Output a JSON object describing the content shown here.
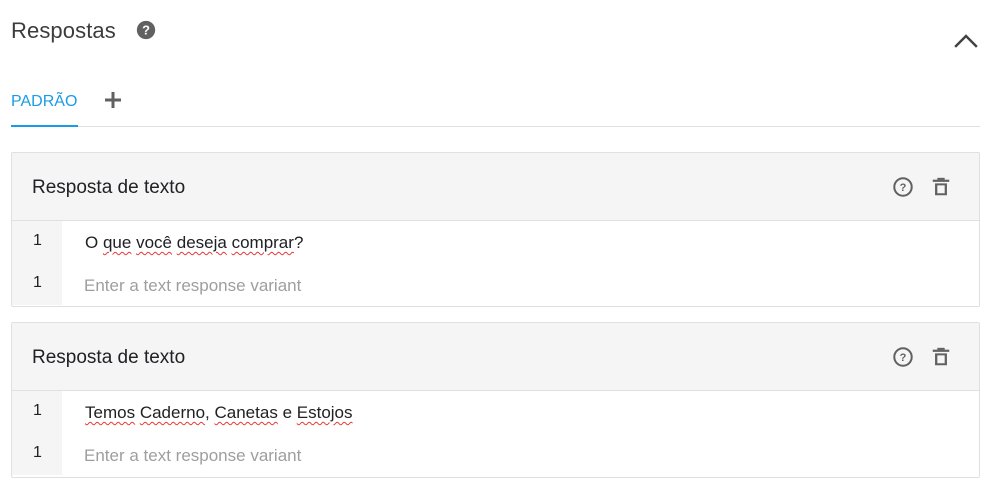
{
  "section": {
    "title": "Respostas"
  },
  "tabs": [
    {
      "label": "PADRÃO",
      "active": true
    }
  ],
  "colors": {
    "accent": "#1a9be6",
    "icon": "#616161",
    "card_header_bg": "#f5f5f5",
    "spellcheck": "#e53935"
  },
  "cards": [
    {
      "title": "Resposta de texto",
      "rows": [
        {
          "index": "1",
          "value": "O que você deseja comprar?"
        },
        {
          "index": "1",
          "placeholder": "Enter a text response variant"
        }
      ]
    },
    {
      "title": "Resposta de texto",
      "rows": [
        {
          "index": "1",
          "value": "Temos Caderno, Canetas e Estojos"
        },
        {
          "index": "1",
          "placeholder": "Enter a text response variant"
        }
      ]
    }
  ]
}
